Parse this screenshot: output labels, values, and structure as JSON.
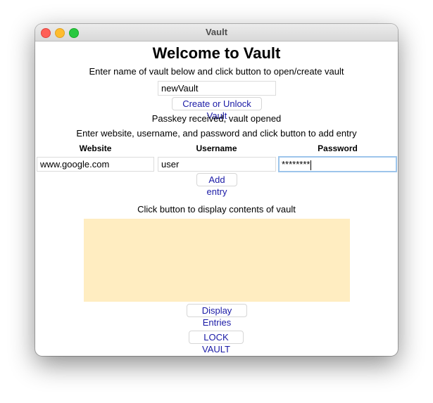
{
  "window": {
    "title": "Vault"
  },
  "main": {
    "heading": "Welcome to Vault",
    "vault_prompt": "Enter name of vault below and click button to open/create vault",
    "vault_name_value": "newVault",
    "create_unlock_label": "Create or Unlock Vault",
    "status_text": "Passkey received, vault opened",
    "entry_prompt": "Enter website, username, and password and click button to add entry",
    "columns": [
      "Website",
      "Username",
      "Password"
    ],
    "website_value": "www.google.com",
    "username_value": "user",
    "password_value": "********",
    "add_entry_label": "Add entry",
    "display_prompt": "Click button to display contents of vault",
    "display_entries_label": "Display Entries",
    "lock_vault_label": "LOCK VAULT"
  },
  "colors": {
    "display_area_bg": "#ffedc1",
    "button_text": "#1a1aa6",
    "focus_ring": "#9dc5eb"
  }
}
